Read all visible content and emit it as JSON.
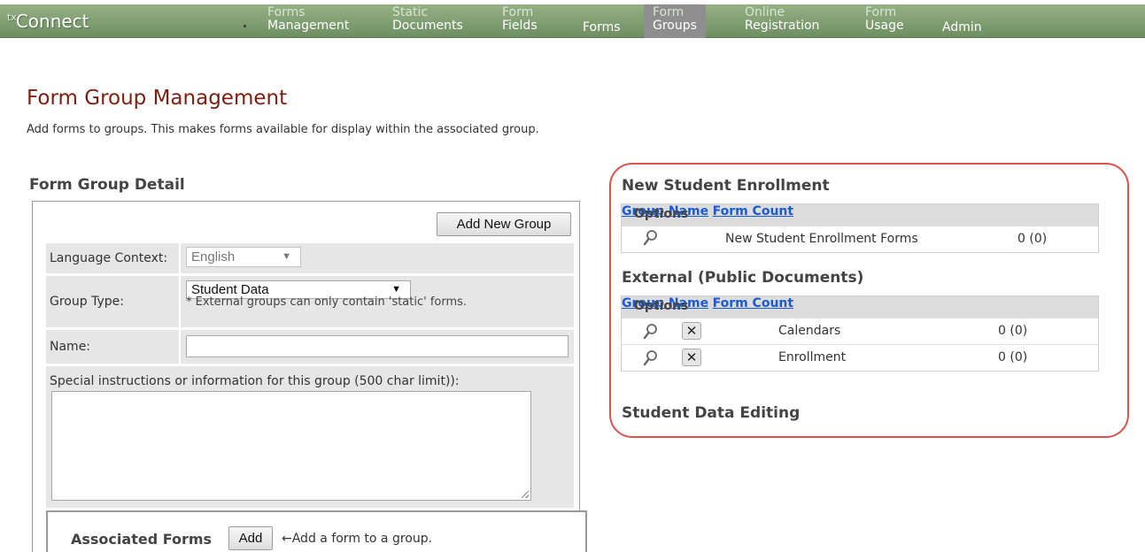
{
  "app": {
    "brand_prefix": "tx",
    "brand_name": "Connect"
  },
  "nav": [
    {
      "line1": "Forms",
      "line2": "Management",
      "active": false
    },
    {
      "line1": "Static",
      "line2": "Documents",
      "active": false
    },
    {
      "line1": "Form",
      "line2": "Fields",
      "active": false
    },
    {
      "line1": "",
      "line2": "Forms",
      "active": false
    },
    {
      "line1": "Form",
      "line2": "Groups",
      "active": true
    },
    {
      "line1": "Online",
      "line2": "Registration",
      "active": false
    },
    {
      "line1": "Form",
      "line2": "Usage",
      "active": false
    },
    {
      "line1": "",
      "line2": "Admin",
      "active": false
    }
  ],
  "page": {
    "title": "Form Group Management",
    "subtitle": "Add forms to groups. This makes forms available for display within the associated group."
  },
  "detail": {
    "heading": "Form Group Detail",
    "add_new_group_label": "Add New Group",
    "language_context_label": "Language Context:",
    "language_context_value": "English",
    "group_type_label": "Group Type:",
    "group_type_value": "Student Data",
    "group_type_hint": "* External groups can only contain 'static' forms.",
    "name_label": "Name:",
    "name_value": "",
    "instructions_label": "Special instructions or information for this group (500 char limit)):",
    "instructions_value": "",
    "associated_forms_label": "Associated Forms",
    "associated_add_label": "Add",
    "associated_hint": "←Add a form to a group."
  },
  "groups": {
    "enrollment": {
      "heading": "New Student Enrollment",
      "col_options": "Options",
      "col_group_name": "Group Name",
      "col_form_count": "Form Count",
      "rows": [
        {
          "name": "New Student Enrollment Forms",
          "count": "0 (0)"
        }
      ]
    },
    "external": {
      "heading": "External (Public Documents)",
      "col_options": "Options",
      "col_group_name": "Group Name",
      "col_form_count": "Form Count",
      "rows": [
        {
          "name": "Calendars",
          "count": "0 (0)"
        },
        {
          "name": "Enrollment",
          "count": "0 (0)"
        }
      ]
    },
    "student_data": {
      "heading": "Student Data Editing"
    }
  },
  "icons": {
    "view": "magnifier-icon",
    "delete": "close-icon",
    "dropdown": "chevron-down-icon"
  },
  "colors": {
    "nav_bg": "#7f9f72",
    "nav_active": "#8e8e8e",
    "title": "#7a1f12",
    "link": "#1a5ad6",
    "highlight": "#d9534f"
  }
}
